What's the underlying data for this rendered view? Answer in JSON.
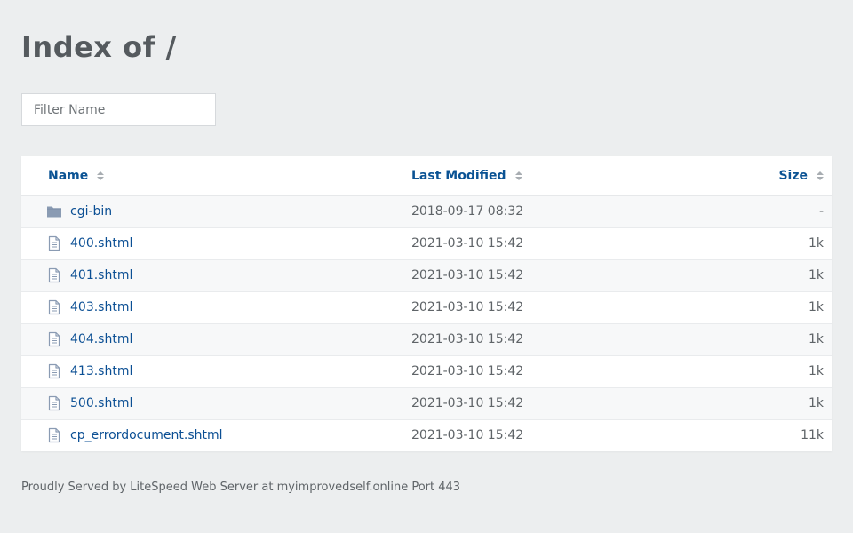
{
  "page": {
    "title": "Index of /"
  },
  "filter": {
    "placeholder": "Filter Name",
    "value": ""
  },
  "table": {
    "headers": {
      "name": "Name",
      "last_modified": "Last Modified",
      "size": "Size"
    },
    "rows": [
      {
        "type": "folder",
        "icon": "folder-icon",
        "name": "cgi-bin",
        "modified": "2018-09-17 08:32",
        "size": "-"
      },
      {
        "type": "file",
        "icon": "file-icon",
        "name": "400.shtml",
        "modified": "2021-03-10 15:42",
        "size": "1k"
      },
      {
        "type": "file",
        "icon": "file-icon",
        "name": "401.shtml",
        "modified": "2021-03-10 15:42",
        "size": "1k"
      },
      {
        "type": "file",
        "icon": "file-icon",
        "name": "403.shtml",
        "modified": "2021-03-10 15:42",
        "size": "1k"
      },
      {
        "type": "file",
        "icon": "file-icon",
        "name": "404.shtml",
        "modified": "2021-03-10 15:42",
        "size": "1k"
      },
      {
        "type": "file",
        "icon": "file-icon",
        "name": "413.shtml",
        "modified": "2021-03-10 15:42",
        "size": "1k"
      },
      {
        "type": "file",
        "icon": "file-icon",
        "name": "500.shtml",
        "modified": "2021-03-10 15:42",
        "size": "1k"
      },
      {
        "type": "file",
        "icon": "file-icon",
        "name": "cp_errordocument.shtml",
        "modified": "2021-03-10 15:42",
        "size": "11k"
      }
    ]
  },
  "footer": {
    "text": "Proudly Served by LiteSpeed Web Server at myimprovedself.online Port 443"
  },
  "colors": {
    "link": "#0b4f94",
    "header_link": "#0b5394",
    "background": "#eceeef",
    "icon": "#8a9bb3"
  }
}
